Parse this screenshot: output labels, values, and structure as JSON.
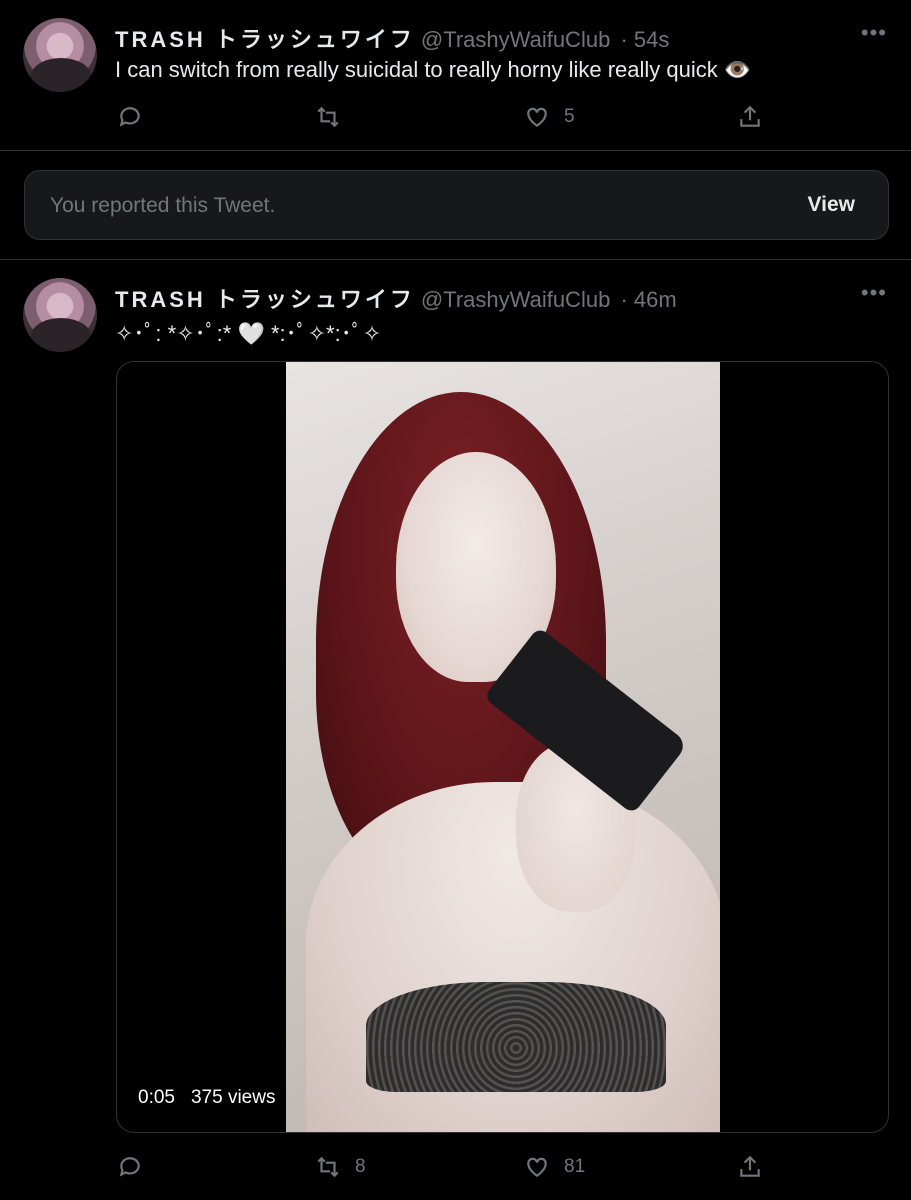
{
  "tweet1": {
    "name": "TRASH トラッシュワイフ",
    "handle": "@TrashyWaifuClub",
    "time": "· 54s",
    "more": "•••",
    "text": "I can switch from really suicidal to really horny like really quick 👁️",
    "reply_count": "",
    "retweet_count": "",
    "like_count": "5"
  },
  "reported": {
    "message": "You reported this Tweet.",
    "view_label": "View"
  },
  "tweet2": {
    "name": "TRASH トラッシュワイフ",
    "handle": "@TrashyWaifuClub",
    "time": "· 46m",
    "more": "•••",
    "text": "✧･ﾟ: *✧･ﾟ:* 🤍 *:･ﾟ✧*:･ﾟ✧",
    "video_time": "0:05",
    "video_views": "375 views",
    "reply_count": "",
    "retweet_count": "8",
    "like_count": "81"
  },
  "icons": {
    "reply": "reply-icon",
    "retweet": "retweet-icon",
    "like": "heart-icon",
    "share": "share-icon"
  },
  "colors": {
    "background": "#000000",
    "text": "#e7e9ea",
    "muted": "#71767b",
    "border": "#2f3336"
  }
}
